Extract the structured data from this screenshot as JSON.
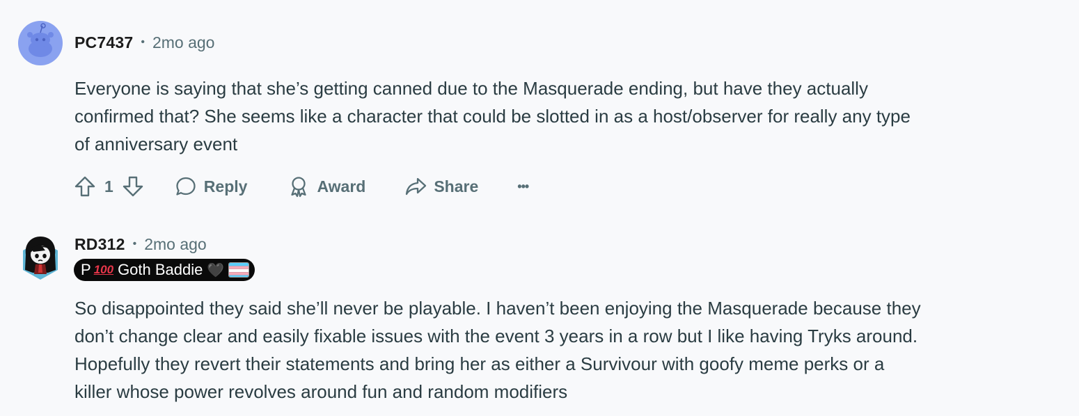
{
  "comments": [
    {
      "username": "PC7437",
      "separator": "•",
      "time": "2mo ago",
      "avatar_icon": "reddit-snoo-avatar-icon",
      "body_lines": [
        "Everyone is saying that she’s getting canned due to the Masquerade ending, but have they actually",
        "confirmed that? She seems like a character that could be slotted in as a host/observer for really any type",
        "of anniversary event"
      ],
      "actions": {
        "upvote_icon": "arrow-up-icon",
        "score": "1",
        "downvote_icon": "arrow-down-icon",
        "reply": "Reply",
        "award": "Award",
        "share": "Share",
        "more": "•••"
      }
    },
    {
      "username": "RD312",
      "separator": "•",
      "time": "2mo ago",
      "avatar_icon": "goth-character-avatar-icon",
      "flair": {
        "prefix": "P",
        "hundred": "100",
        "text": "Goth Baddie",
        "heart": "🖤",
        "flag_icon": "trans-flag-icon"
      },
      "body_lines": [
        "So disappointed they said she’ll never be playable. I haven’t been enjoying the Masquerade because they",
        "don’t change clear and easily fixable issues with the event 3 years in a row but I like having Tryks around.",
        "Hopefully they revert their statements and bring her as either a Survivour with goofy meme perks or a",
        "killer whose power revolves around fun and random modifiers"
      ]
    }
  ],
  "colors": {
    "background": "#f8f9fb",
    "meta_text": "#576f76",
    "body_text": "#2a3c42",
    "avatar_blue": "#8aa2f0",
    "flair_bg": "#0a0a0a",
    "trans_blue": "#5bcefa",
    "trans_pink": "#f5a9b8"
  }
}
